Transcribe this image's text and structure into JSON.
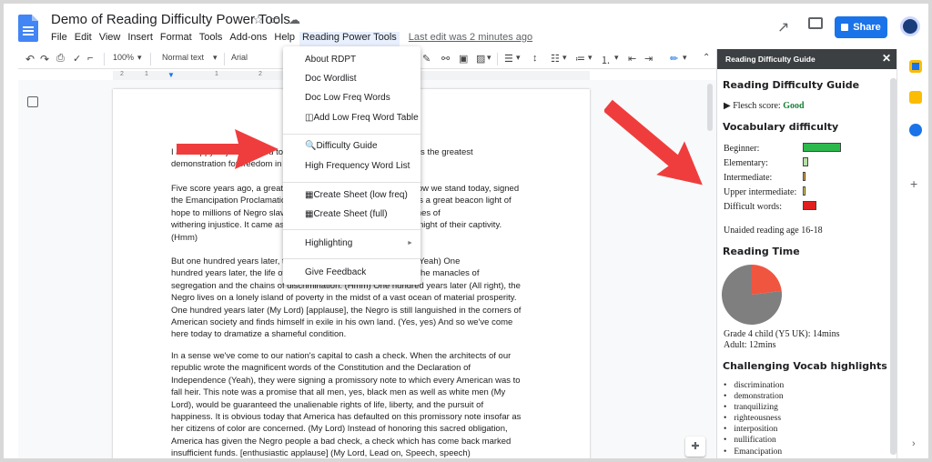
{
  "header": {
    "doc_title": "Demo of Reading Difficulty Power Tools",
    "icons": [
      "star-icon",
      "folder-icon",
      "cloud-icon"
    ],
    "menu": [
      "File",
      "Edit",
      "View",
      "Insert",
      "Format",
      "Tools",
      "Add-ons",
      "Help",
      "Reading Power Tools"
    ],
    "last_edit": "Last edit was 2 minutes ago",
    "share_label": "Share",
    "colors": {
      "share": "#1a73e8",
      "doc_blue": "#4285f4"
    }
  },
  "toolbar": {
    "zoom": "100%",
    "style": "Normal text",
    "font": "Arial"
  },
  "ruler": [
    "2",
    "1",
    "1",
    "2",
    "3",
    "4"
  ],
  "document": {
    "paragraphs": [
      [
        "I am happy to join with you today in what will go down in history as the greatest",
        "demonstration for freedom in the history of our nation. [applause]"
      ],
      [
        "Five score years ago, a great American, in whose symbolic shadow we stand today, signed",
        "the Emancipation Proclamation. This momentous decree came as a great beacon light of",
        "hope to millions of Negro slaves who had been seared in the flames of",
        "withering injustice. It came as a joyous daybreak to end the long night of their captivity.",
        "(Hmm)"
      ],
      [
        "But one hundred years later, the Negro still is not free. (My Lord, Yeah) One",
        "hundred years later, the life of the Negro is still sadly crippled by the manacles of",
        "segregation and the chains of discrimination. (Hmm) One hundred years later (All right), the",
        "Negro lives on a lonely island of poverty in the midst of a vast ocean of material prosperity.",
        "One hundred years later (My Lord) [applause], the Negro is still languished in the corners of",
        "American society and finds himself in exile in his own land. (Yes, yes) And so we've come",
        "here today to dramatize a shameful condition."
      ],
      [
        "In a sense we've come to our nation's capital to cash a check. When the architects of our",
        "republic wrote the magnificent words of the Constitution and the Declaration of",
        "Independence (Yeah), they were signing a promissory note to which every American was to",
        "fall heir. This note was a promise that all men, yes, black men as well as white men (My",
        "Lord), would be guaranteed the unalienable rights of life, liberty, and the pursuit of",
        "happiness. It is obvious today that America has defaulted on this promissory note insofar as",
        "her citizens of color are concerned. (My Lord) Instead of honoring this sacred obligation,",
        "America has given the Negro people a bad check, a check which has come back marked",
        "insufficient funds. [enthusiastic applause] (My Lord, Lead on, Speech, speech)"
      ]
    ]
  },
  "dropdown": {
    "items": [
      "About RDPT",
      "Doc Wordlist",
      "Doc Low Freq Words",
      "◫Add Low Freq Word Table",
      "🔍Difficulty Guide",
      "High Frequency Word List",
      "▦Create Sheet (low freq)",
      "▦Create Sheet (full)",
      "Highlighting",
      "Give Feedback"
    ],
    "highlighted": "🔍Difficulty Guide"
  },
  "panel": {
    "title": "Reading Difficulty Guide",
    "h_guide": "Reading Difficulty Guide",
    "flesch_label": "▶ Flesch score: ",
    "flesch_value": "Good",
    "h_vocab": "Vocabulary difficulty",
    "vocab_levels": [
      {
        "label": "Beginner:",
        "fraction": 1.0,
        "color": "#2db84d"
      },
      {
        "label": "Elementary:",
        "fraction": 0.15,
        "color": "#b7e0a6"
      },
      {
        "label": "Intermediate:",
        "fraction": 0.05,
        "color": "#f4a935"
      },
      {
        "label": "Upper intermediate:",
        "fraction": 0.08,
        "color": "#f5e35a"
      },
      {
        "label": "Difficult words:",
        "fraction": 0.35,
        "color": "#e02020"
      }
    ],
    "unaided_age": "Unaided reading age 16-18",
    "h_time": "Reading Time",
    "pie": {
      "slices": [
        {
          "value": 0.77,
          "color": "#7f7f7f"
        },
        {
          "value": 0.23,
          "color": "#f05540"
        }
      ]
    },
    "time_child": "Grade 4 child (Y5 UK): 14mins",
    "time_adult": "Adult: 12mins",
    "h_highlights": "Challenging Vocab highlights",
    "highlights": [
      "discrimination",
      "demonstration",
      "tranquilizing",
      "righteousness",
      "interposition",
      "nullification",
      "Emancipation"
    ]
  }
}
